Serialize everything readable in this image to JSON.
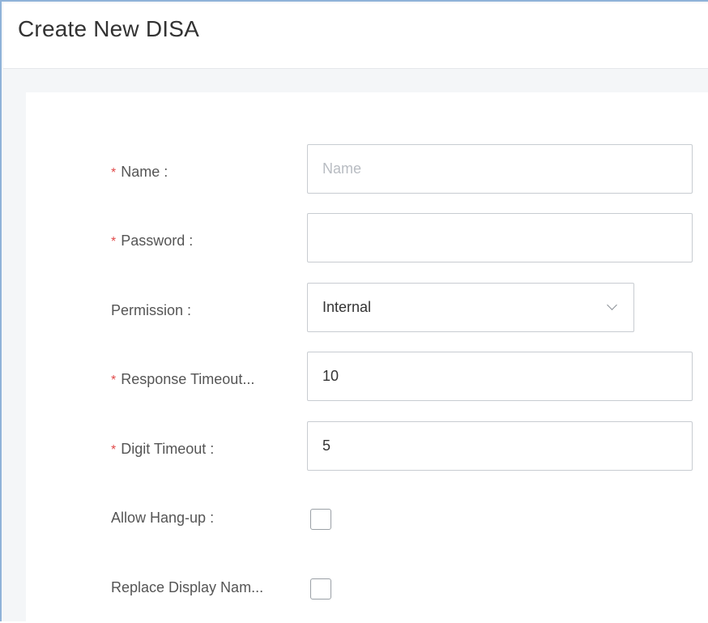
{
  "header": {
    "title": "Create New DISA"
  },
  "form": {
    "name": {
      "label": "Name :",
      "placeholder": "Name",
      "value": "",
      "required": true
    },
    "password": {
      "label": "Password :",
      "value": "",
      "required": true
    },
    "permission": {
      "label": "Permission :",
      "value": "Internal"
    },
    "response_timeout": {
      "label": "Response Timeout...",
      "value": "10",
      "required": true
    },
    "digit_timeout": {
      "label": "Digit Timeout :",
      "value": "5",
      "required": true
    },
    "allow_hangup": {
      "label": "Allow Hang-up :",
      "checked": false
    },
    "replace_display_name": {
      "label": "Replace Display Nam...",
      "checked": false
    },
    "required_marker": "*"
  },
  "colors": {
    "required": "#e14b4b",
    "frame_border": "#8fb3d9",
    "background": "#f4f6f8"
  }
}
